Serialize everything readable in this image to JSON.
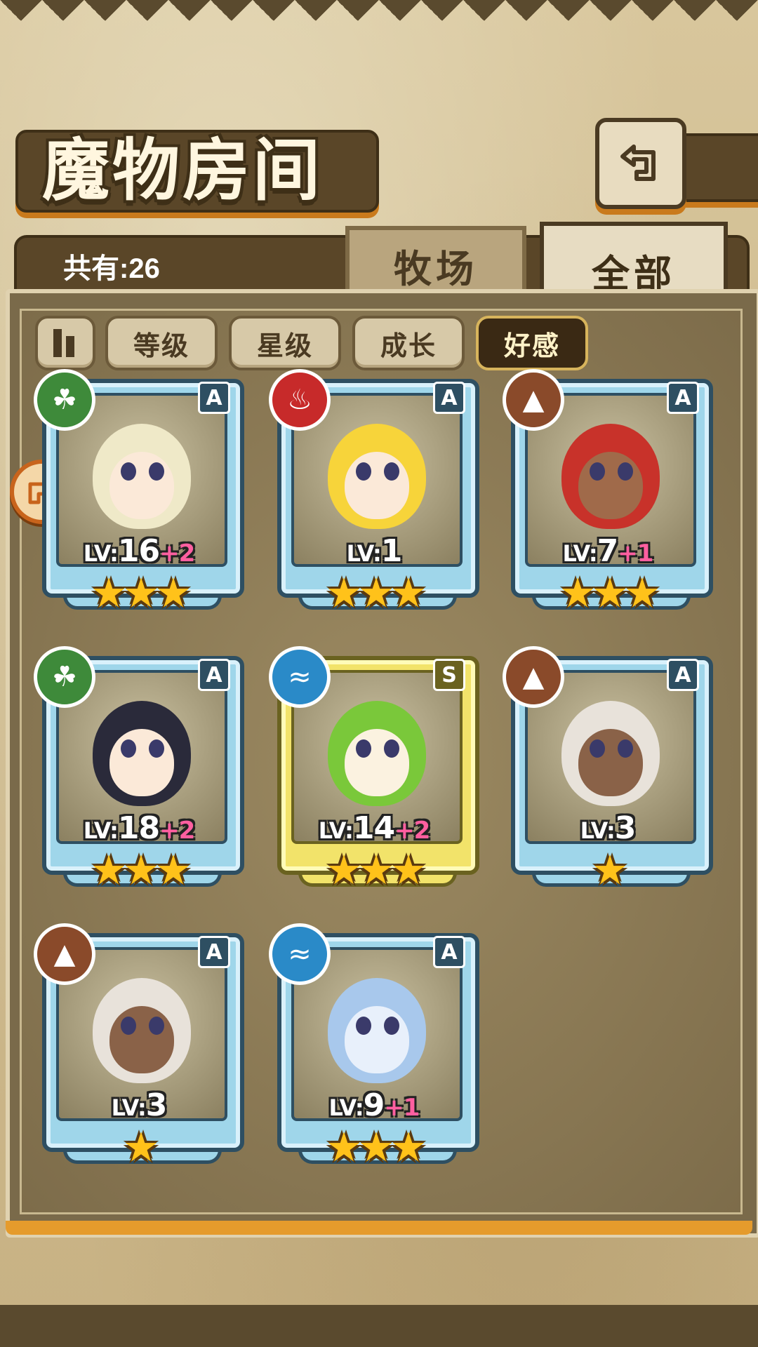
{
  "header": {
    "title": "魔物房间",
    "back_icon": "return-arrow-icon"
  },
  "count_label": "共有:26",
  "tabs": [
    {
      "label": "牧场",
      "active": false
    },
    {
      "label": "全部",
      "active": true
    }
  ],
  "filters": {
    "sort_icon": "sort-order-icon",
    "buttons": [
      {
        "label": "等级",
        "active": false
      },
      {
        "label": "星级",
        "active": false
      },
      {
        "label": "成长",
        "active": false
      },
      {
        "label": "好感",
        "active": true
      }
    ]
  },
  "side_button_icon": "arrow-pointer-icon",
  "monsters": [
    {
      "element": "grass",
      "element_icon": "leaf-icon",
      "element_color": "#3e8a3a",
      "rank": "A",
      "level": "LV:16",
      "bonus": "+2",
      "stars": 3,
      "frame": "blue",
      "hair": "#efe9c8",
      "skin": "#fbe9d8"
    },
    {
      "element": "fire",
      "element_icon": "flame-icon",
      "element_color": "#c72a2a",
      "rank": "A",
      "level": "LV:1",
      "bonus": "",
      "stars": 3,
      "frame": "blue",
      "hair": "#f7d43a",
      "skin": "#fbe9d8"
    },
    {
      "element": "earth",
      "element_icon": "mountain-icon",
      "element_color": "#8a4a2a",
      "rank": "A",
      "level": "LV:7",
      "bonus": "+1",
      "stars": 3,
      "frame": "blue",
      "hair": "#c8322a",
      "skin": "#a06a4a"
    },
    {
      "element": "grass",
      "element_icon": "leaf-icon",
      "element_color": "#3e8a3a",
      "rank": "A",
      "level": "LV:18",
      "bonus": "+2",
      "stars": 3,
      "frame": "blue",
      "hair": "#2a2a3a",
      "skin": "#fbe9d8"
    },
    {
      "element": "water",
      "element_icon": "water-waves-icon",
      "element_color": "#2a8ac8",
      "rank": "S",
      "level": "LV:14",
      "bonus": "+2",
      "stars": 3,
      "frame": "gold",
      "hair": "#7ac83a",
      "skin": "#fbf2e0"
    },
    {
      "element": "earth",
      "element_icon": "mountain-icon",
      "element_color": "#8a4a2a",
      "rank": "A",
      "level": "LV:3",
      "bonus": "",
      "stars": 1,
      "frame": "blue",
      "hair": "#e8e2da",
      "skin": "#8a6248"
    },
    {
      "element": "earth",
      "element_icon": "mountain-icon",
      "element_color": "#8a4a2a",
      "rank": "A",
      "level": "LV:3",
      "bonus": "",
      "stars": 1,
      "frame": "blue",
      "hair": "#e8e2da",
      "skin": "#8a6248"
    },
    {
      "element": "water",
      "element_icon": "water-waves-icon",
      "element_color": "#2a8ac8",
      "rank": "A",
      "level": "LV:9",
      "bonus": "+1",
      "stars": 3,
      "frame": "blue",
      "hair": "#a8c8ec",
      "skin": "#e8f0fb"
    }
  ]
}
